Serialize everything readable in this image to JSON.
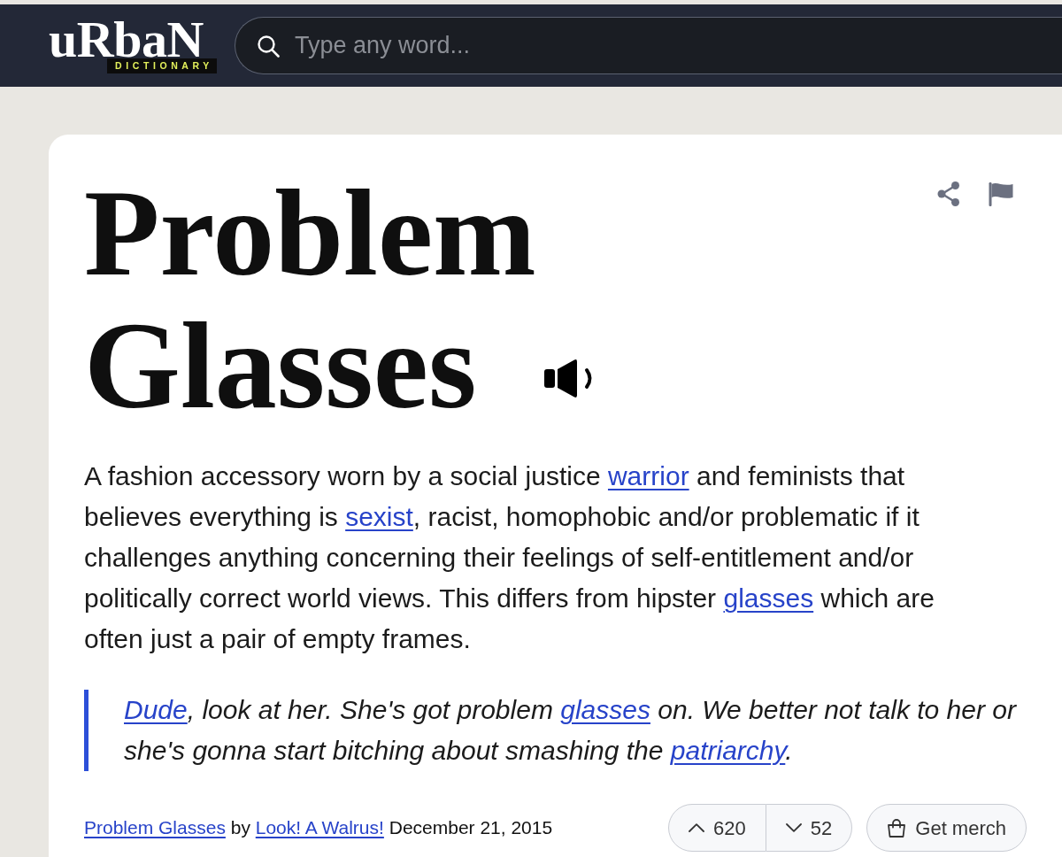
{
  "header": {
    "logo": {
      "wordmark": "uRbaN",
      "tagline": "DICTIONARY"
    },
    "search": {
      "placeholder": "Type any word..."
    }
  },
  "entry": {
    "title": "Problem Glasses",
    "definition": [
      {
        "kind": "text",
        "text": "A fashion accessory worn by a social justice "
      },
      {
        "kind": "link",
        "text": "warrior"
      },
      {
        "kind": "text",
        "text": " and feminists that believes everything is "
      },
      {
        "kind": "link",
        "text": "sexist"
      },
      {
        "kind": "text",
        "text": ", racist, homophobic and/or problematic if it challenges anything concerning their feelings of self-entitlement and/or politically correct world views. This differs from hipster "
      },
      {
        "kind": "link",
        "text": "glasses"
      },
      {
        "kind": "text",
        "text": " which are often just a pair of empty frames."
      }
    ],
    "example": [
      {
        "kind": "link",
        "text": "Dude"
      },
      {
        "kind": "text",
        "text": ", look at her. She's got problem "
      },
      {
        "kind": "link",
        "text": "glasses"
      },
      {
        "kind": "text",
        "text": " on. We better not talk to her or she's gonna start bitching about smashing the "
      },
      {
        "kind": "link",
        "text": "patriarchy"
      },
      {
        "kind": "text",
        "text": "."
      }
    ],
    "byline": [
      {
        "kind": "term_link",
        "text": "Problem Glasses"
      },
      {
        "kind": "text",
        "text": " by "
      },
      {
        "kind": "author_link",
        "text": "Look! A Walrus!"
      },
      {
        "kind": "text",
        "text": " December 21, 2015"
      }
    ],
    "votes": {
      "up": "620",
      "down": "52"
    },
    "merch_button": "Get merch"
  }
}
